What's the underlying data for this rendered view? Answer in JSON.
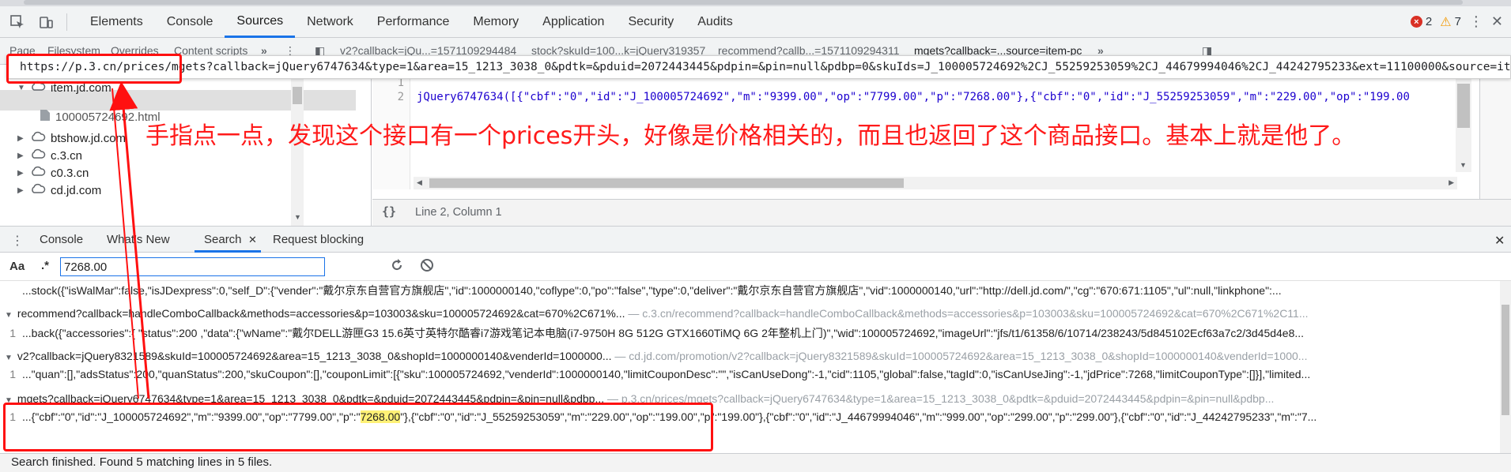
{
  "toolbar": {
    "tabs": [
      "Elements",
      "Console",
      "Sources",
      "Network",
      "Performance",
      "Memory",
      "Application",
      "Security",
      "Audits"
    ],
    "active_tab": "Sources",
    "errors": "2",
    "warnings": "7"
  },
  "sources": {
    "nav_tabs": [
      "Page",
      "Filesystem",
      "Overrides",
      "Content scripts"
    ],
    "open_files": [
      "v2?callback=jQu...=1571109294484",
      "stock?skuId=100...k=jQuery319357",
      "recommend?callb...=1571109294311",
      "mgets?callback=...source=item-pc"
    ],
    "url": "https://p.3.cn/prices/mgets?callback=jQuery6747634&type=1&area=15_1213_3038_0&pdtk=&pduid=2072443445&pdpin=&pin=null&pdbp=0&skuIds=J_100005724692%2CJ_55259253059%2CJ_44679994046%2CJ_44242795233&ext=11100000&source=item-pc",
    "tree": [
      {
        "label": "item.jd.com",
        "level": 1,
        "expanded": true,
        "icon": "cloud-icon"
      },
      {
        "label": "100005724692.html",
        "level": 2,
        "selected": true,
        "icon": "file-icon"
      },
      {
        "label": "btshow.jd.com",
        "level": 1,
        "expanded": false,
        "icon": "cloud-icon"
      },
      {
        "label": "c.3.cn",
        "level": 1,
        "expanded": false,
        "icon": "cloud-icon"
      },
      {
        "label": "c0.3.cn",
        "level": 1,
        "expanded": false,
        "icon": "cloud-icon"
      },
      {
        "label": "cd.jd.com",
        "level": 1,
        "expanded": false,
        "icon": "cloud-icon"
      }
    ],
    "editor_line_numbers": [
      "1",
      "2"
    ],
    "editor_line_2": "jQuery6747634([{\"cbf\":\"0\",\"id\":\"J_100005724692\",\"m\":\"9399.00\",\"op\":\"7799.00\",\"p\":\"7268.00\"},{\"cbf\":\"0\",\"id\":\"J_55259253059\",\"m\":\"229.00\",\"op\":\"199.00",
    "cursor_position": "Line 2, Column 1",
    "format_icon": "{}"
  },
  "drawer": {
    "tabs": [
      "Console",
      "What's New",
      "Search",
      "Request blocking"
    ],
    "active_tab": "Search",
    "search_value": "7268.00",
    "case_label": "Aa",
    "regex_label": ".*",
    "results": [
      {
        "type": "line",
        "text": "...stock({\"isWalMar\":false,\"isJDexpress\":0,\"self_D\":{\"vender\":\"戴尔京东自营官方旗舰店\",\"id\":1000000140,\"coflype\":0,\"po\":\"false\",\"type\":0,\"deliver\":\"戴尔京东自营官方旗舰店\",\"vid\":1000000140,\"url\":\"http://dell.jd.com/\",\"cg\":\"670:671:1105\",\"ul\":null,\"linkphone\":..."
      },
      {
        "type": "file",
        "name": "recommend?callback=handleComboCallback&methods=accessories&p=103003&sku=100005724692&cat=670%2C671%...",
        "url": "— c.3.cn/recommend?callback=handleComboCallback&methods=accessories&p=103003&sku=100005724692&cat=670%2C671%2C11..."
      },
      {
        "type": "line",
        "text": "...back({\"accessories\":{  \"status\":200 ,\"data\":{\"wName\":\"戴尔DELL游匣G3 15.6英寸英特尔酷睿i7游戏笔记本电脑(i7-9750H 8G 512G GTX1660TiMQ 6G 2年整机上门)\",\"wid\":100005724692,\"imageUrl\":\"jfs/t1/61358/6/10714/238243/5d845102Ecf63a7c2/3d45d4e8..."
      },
      {
        "type": "file",
        "name": "v2?callback=jQuery8321589&skuId=100005724692&area=15_1213_3038_0&shopId=1000000140&venderId=1000000...",
        "url": "— cd.jd.com/promotion/v2?callback=jQuery8321589&skuId=100005724692&area=15_1213_3038_0&shopId=1000000140&venderId=1000..."
      },
      {
        "type": "line",
        "text": "...\"quan\":[],\"adsStatus\":200,\"quanStatus\":200,\"skuCoupon\":[],\"couponLimit\":[{\"sku\":100005724692,\"venderId\":1000000140,\"limitCouponDesc\":\"\",\"isCanUseDong\":-1,\"cid\":1105,\"global\":false,\"tagId\":0,\"isCanUseJing\":-1,\"jdPrice\":7268,\"limitCouponType\":[]}],\"limited..."
      },
      {
        "type": "file",
        "name": "mgets?callback=jQuery6747634&type=1&area=15_1213_3038_0&pdtk=&pduid=2072443445&pdpin=&pin=null&pdbp...",
        "url": "— p.3.cn/prices/mgets?callback=jQuery6747634&type=1&area=15_1213_3038_0&pdtk=&pduid=2072443445&pdpin=&pin=null&pdbp..."
      },
      {
        "type": "line",
        "pre": "...{\"cbf\":\"0\",\"id\":\"J_100005724692\",\"m\":\"9399.00\",\"op\":\"7799.00\",\"p\":\"",
        "highlight": "7268.00",
        "post": "\"},{\"cbf\":\"0\",\"id\":\"J_55259253059\",\"m\":\"229.00\",\"op\":\"199.00\",\"p\":\"199.00\"},{\"cbf\":\"0\",\"id\":\"J_44679994046\",\"m\":\"999.00\",\"op\":\"299.00\",\"p\":\"299.00\"},{\"cbf\":\"0\",\"id\":\"J_44242795233\",\"m\":\"7..."
      }
    ],
    "line_number": "1",
    "status": "Search finished.  Found 5 matching lines in 5 files."
  },
  "annotation": {
    "text": "手指点一点，发现这个接口有一个prices开头，好像是价格相关的，而且也返回了这个商品接口。基本上就是他了。",
    "color": "#ff1a1a"
  }
}
